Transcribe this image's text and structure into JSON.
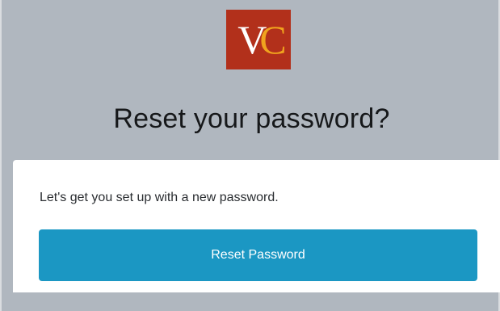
{
  "logo": {
    "letter_1": "V",
    "letter_2": "C",
    "background_color": "#b2301b",
    "letter_1_color": "#ffffff",
    "letter_2_color": "#f0a31e"
  },
  "heading": {
    "title": "Reset your password?"
  },
  "card": {
    "message": "Let's get you set up with a new password.",
    "button_label": "Reset Password",
    "button_color": "#1b97c3"
  },
  "colors": {
    "page_background": "#b0b7bf",
    "card_background": "#ffffff",
    "title_text": "#16181a"
  }
}
